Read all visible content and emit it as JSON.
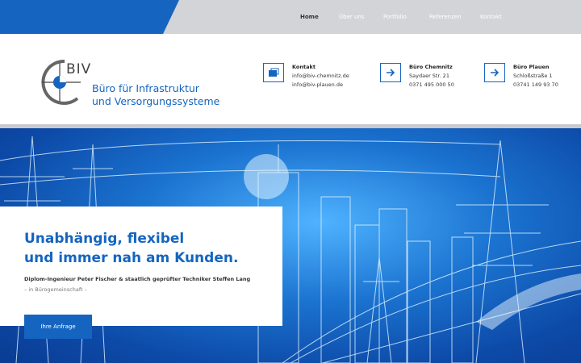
{
  "nav": {
    "items": [
      "Home",
      "Über uns",
      "Portfolio",
      "Referenzen",
      "Kontakt"
    ]
  },
  "logo": {
    "abbr": "BIV",
    "line1": "Büro für Infrastruktur",
    "line2": "und Versorgungssysteme"
  },
  "contact": {
    "title": "Kontakt",
    "email1": "info@biv-chemnitz.de",
    "email2": "info@biv-plauen.de"
  },
  "office_chemnitz": {
    "title": "Büro Chemnitz",
    "street": "Saydaer Str. 21",
    "phone": "0371 495 000 50"
  },
  "office_plauen": {
    "title": "Büro Plauen",
    "street": "Schloßstraße 1",
    "phone": "03741 149 93 70"
  },
  "hero": {
    "headline1": "Unabhängig, flexibel",
    "headline2": "und immer nah am Kunden.",
    "subline": "Diplom-Ingenieur Peter Fischer & staatlich geprüfter Techniker Steffen Lang",
    "subline2": "– in Bürogemeinschaft –",
    "cta": "Ihre Anfrage"
  },
  "colors": {
    "accent": "#1565c0",
    "topbar": "#d2d4d7"
  },
  "icons": {
    "contact": "contact-card-icon",
    "office": "arrow-right-icon"
  }
}
